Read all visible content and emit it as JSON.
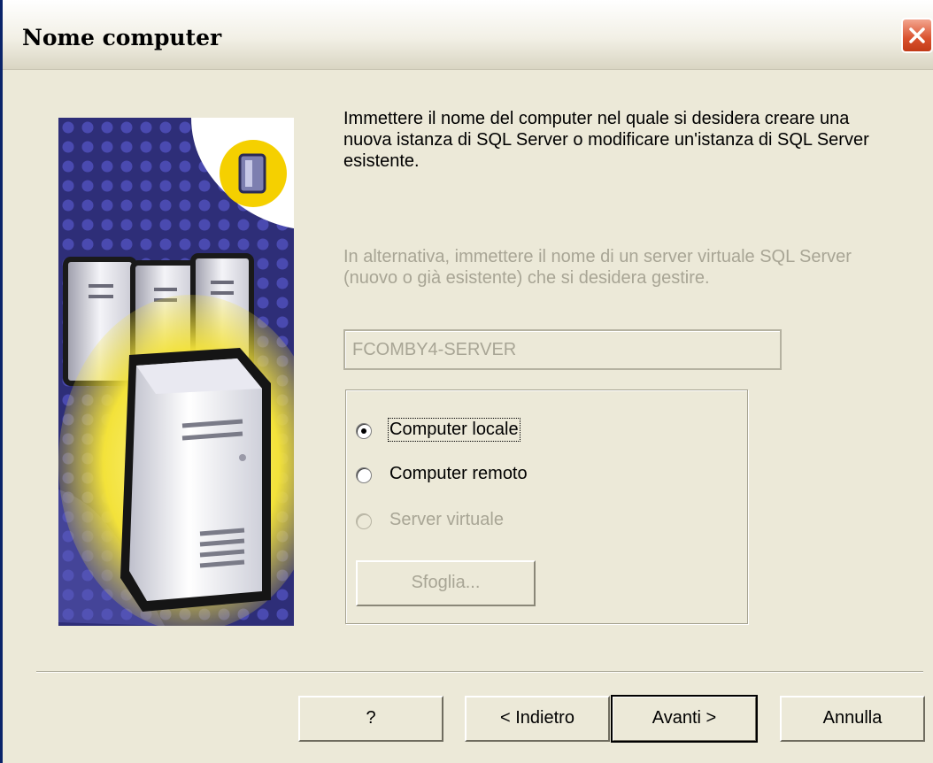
{
  "window": {
    "title": "Nome computer"
  },
  "description": "Immettere il nome del computer nel quale si desidera creare una nuova istanza di SQL Server o modificare un'istanza di SQL Server esistente.",
  "alternative_description": "In alternativa, immettere il nome di un server virtuale SQL Server (nuovo o già esistente) che si desidera gestire.",
  "computer_name_field": {
    "value": "FCOMBY4-SERVER",
    "enabled": false
  },
  "options": [
    {
      "label": "Computer locale",
      "selected": true,
      "enabled": true
    },
    {
      "label": "Computer remoto",
      "selected": false,
      "enabled": true
    },
    {
      "label": "Server virtuale",
      "selected": false,
      "enabled": false
    }
  ],
  "browse_button": {
    "label": "Sfoglia...",
    "enabled": false
  },
  "buttons": {
    "help": "?",
    "back": "< Indietro",
    "next": "Avanti >",
    "cancel": "Annulla"
  },
  "icons": {
    "close": "close-icon",
    "wizard_art": "server-computers-illustration",
    "badge": "server-badge-icon"
  },
  "colors": {
    "dialog_bg": "#ece9d8",
    "disabled_text": "#a8a595",
    "close_red": "#d9512e",
    "art_blue": "#30307a",
    "art_yellow": "#f5d000"
  }
}
